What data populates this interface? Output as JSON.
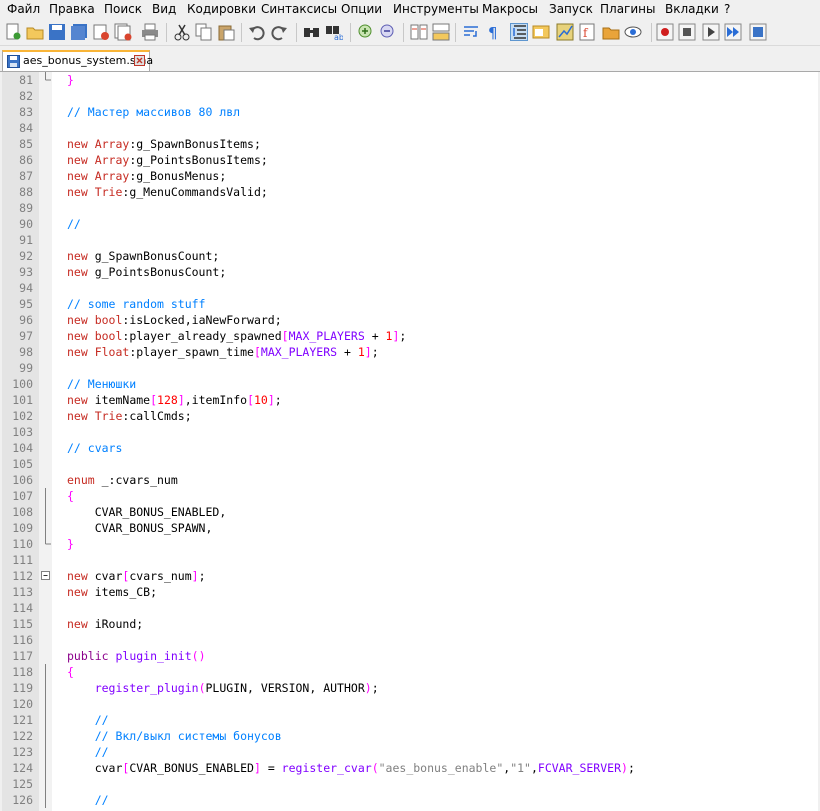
{
  "menu": [
    "Файл",
    "Правка",
    "Поиск",
    "Вид",
    "Кодировки",
    "Синтаксисы",
    "Опции",
    "Инструменты",
    "Макросы",
    "Запуск",
    "Плагины",
    "Вкладки",
    "?"
  ],
  "toolbar_icons": [
    "new-file-icon",
    "open-file-icon",
    "save-icon",
    "save-all-icon",
    "close-icon",
    "close-all-icon",
    "print-icon",
    "cut-icon",
    "copy-icon",
    "paste-icon",
    "undo-icon",
    "redo-icon",
    "find-icon",
    "replace-icon",
    "zoom-in-icon",
    "zoom-out-icon",
    "sync-vertical-icon",
    "sync-horizontal-icon",
    "word-wrap-icon",
    "show-all-chars-icon",
    "indent-guide-icon",
    "user-defined-lang-icon",
    "doc-map-icon",
    "function-list-icon",
    "folder-workspace-icon",
    "monitoring-icon",
    "record-macro-icon",
    "stop-record-icon",
    "playback-macro-icon",
    "run-macro-multiple-icon",
    "save-macro-icon"
  ],
  "tab": {
    "filename": "aes_bonus_system.sma"
  },
  "colors": {
    "keyword": "#c62b22",
    "comment": "#0080ff",
    "function": "#8b008b",
    "number": "#ff0000",
    "bracket": "#ff00ff",
    "tab_accent": "#f9b538"
  },
  "lines": [
    {
      "n": "81",
      "fold": "end",
      "code": [
        [
          "}",
          "br"
        ]
      ]
    },
    {
      "n": "82",
      "fold": "",
      "code": []
    },
    {
      "n": "83",
      "fold": "",
      "code": [
        [
          "// Мастер массивов 80 лвл",
          "cm"
        ]
      ]
    },
    {
      "n": "84",
      "fold": "",
      "code": []
    },
    {
      "n": "85",
      "fold": "",
      "code": [
        [
          "new ",
          "kw"
        ],
        [
          "Array",
          "kw"
        ],
        [
          ":g_SpawnBonusItems;",
          ""
        ]
      ]
    },
    {
      "n": "86",
      "fold": "",
      "code": [
        [
          "new ",
          "kw"
        ],
        [
          "Array",
          "kw"
        ],
        [
          ":g_PointsBonusItems;",
          ""
        ]
      ]
    },
    {
      "n": "87",
      "fold": "",
      "code": [
        [
          "new ",
          "kw"
        ],
        [
          "Array",
          "kw"
        ],
        [
          ":g_BonusMenus;",
          ""
        ]
      ]
    },
    {
      "n": "88",
      "fold": "",
      "code": [
        [
          "new ",
          "kw"
        ],
        [
          "Trie",
          "kw"
        ],
        [
          ":g_MenuCommandsValid;",
          ""
        ]
      ]
    },
    {
      "n": "89",
      "fold": "",
      "code": []
    },
    {
      "n": "90",
      "fold": "",
      "code": [
        [
          "//",
          "cm"
        ]
      ]
    },
    {
      "n": "91",
      "fold": "",
      "code": []
    },
    {
      "n": "92",
      "fold": "",
      "code": [
        [
          "new ",
          "kw"
        ],
        [
          "g_SpawnBonusCount;",
          ""
        ]
      ]
    },
    {
      "n": "93",
      "fold": "",
      "code": [
        [
          "new ",
          "kw"
        ],
        [
          "g_PointsBonusCount;",
          ""
        ]
      ]
    },
    {
      "n": "94",
      "fold": "",
      "code": []
    },
    {
      "n": "95",
      "fold": "",
      "code": [
        [
          "// some random stuff",
          "cm"
        ]
      ]
    },
    {
      "n": "96",
      "fold": "",
      "code": [
        [
          "new ",
          "kw"
        ],
        [
          "bool",
          "kw"
        ],
        [
          ":isLocked,iaNewForward;",
          ""
        ]
      ]
    },
    {
      "n": "97",
      "fold": "",
      "code": [
        [
          "new ",
          "kw"
        ],
        [
          "bool",
          "kw"
        ],
        [
          ":player_already_spawned",
          ""
        ],
        [
          "[",
          "br"
        ],
        [
          "MAX_PLAYERS",
          "cn"
        ],
        [
          " + ",
          ""
        ],
        [
          "1",
          "nm"
        ],
        [
          "]",
          "br"
        ],
        [
          ";",
          ""
        ]
      ]
    },
    {
      "n": "98",
      "fold": "",
      "code": [
        [
          "new ",
          "kw"
        ],
        [
          "Float",
          "kw"
        ],
        [
          ":player_spawn_time",
          ""
        ],
        [
          "[",
          "br"
        ],
        [
          "MAX_PLAYERS",
          "cn"
        ],
        [
          " + ",
          ""
        ],
        [
          "1",
          "nm"
        ],
        [
          "]",
          "br"
        ],
        [
          ";",
          ""
        ]
      ]
    },
    {
      "n": "99",
      "fold": "",
      "code": []
    },
    {
      "n": "100",
      "fold": "",
      "code": [
        [
          "// Менюшки",
          "cm"
        ]
      ]
    },
    {
      "n": "101",
      "fold": "",
      "code": [
        [
          "new ",
          "kw"
        ],
        [
          "itemName",
          ""
        ],
        [
          "[",
          "br"
        ],
        [
          "128",
          "nm"
        ],
        [
          "]",
          "br"
        ],
        [
          ",itemInfo",
          ""
        ],
        [
          "[",
          "br"
        ],
        [
          "10",
          "nm"
        ],
        [
          "]",
          "br"
        ],
        [
          ";",
          ""
        ]
      ]
    },
    {
      "n": "102",
      "fold": "",
      "code": [
        [
          "new ",
          "kw"
        ],
        [
          "Trie",
          "kw"
        ],
        [
          ":callCmds;",
          ""
        ]
      ]
    },
    {
      "n": "103",
      "fold": "",
      "code": []
    },
    {
      "n": "104",
      "fold": "",
      "code": [
        [
          "// cvars",
          "cm"
        ]
      ]
    },
    {
      "n": "105",
      "fold": "",
      "code": []
    },
    {
      "n": "106",
      "fold": "",
      "code": [
        [
          "enum ",
          "kw"
        ],
        [
          "_:cvars_num",
          ""
        ]
      ]
    },
    {
      "n": "107",
      "fold": "open",
      "code": [
        [
          "{",
          "br"
        ]
      ]
    },
    {
      "n": "108",
      "fold": "line",
      "code": [
        [
          "    CVAR_BONUS_ENABLED,",
          ""
        ]
      ]
    },
    {
      "n": "109",
      "fold": "line",
      "code": [
        [
          "    CVAR_BONUS_SPAWN,",
          ""
        ]
      ]
    },
    {
      "n": "110",
      "fold": "end",
      "code": [
        [
          "}",
          "br"
        ]
      ]
    },
    {
      "n": "111",
      "fold": "",
      "code": []
    },
    {
      "n": "112",
      "fold": "box",
      "code": [
        [
          "new ",
          "kw"
        ],
        [
          "cvar",
          ""
        ],
        [
          "[",
          "br"
        ],
        [
          "cvars_num",
          ""
        ],
        [
          "]",
          "br"
        ],
        [
          ";",
          ""
        ]
      ]
    },
    {
      "n": "113",
      "fold": "",
      "code": [
        [
          "new ",
          "kw"
        ],
        [
          "items_CB;",
          ""
        ]
      ]
    },
    {
      "n": "114",
      "fold": "",
      "code": []
    },
    {
      "n": "115",
      "fold": "",
      "code": [
        [
          "new ",
          "kw"
        ],
        [
          "iRound;",
          ""
        ]
      ]
    },
    {
      "n": "116",
      "fold": "",
      "code": []
    },
    {
      "n": "117",
      "fold": "",
      "code": [
        [
          "public ",
          "fn"
        ],
        [
          "plugin_init",
          "pl"
        ],
        [
          "()",
          "br"
        ]
      ]
    },
    {
      "n": "118",
      "fold": "open",
      "code": [
        [
          "{",
          "br"
        ]
      ]
    },
    {
      "n": "119",
      "fold": "line",
      "code": [
        [
          "    ",
          ""
        ],
        [
          "register_plugin",
          "pl"
        ],
        [
          "(",
          "br"
        ],
        [
          "PLUGIN, VERSION, AUTHOR",
          ""
        ],
        [
          ")",
          "br"
        ],
        [
          ";",
          ""
        ]
      ]
    },
    {
      "n": "120",
      "fold": "line",
      "code": []
    },
    {
      "n": "121",
      "fold": "line",
      "code": [
        [
          "    //",
          "cm"
        ]
      ]
    },
    {
      "n": "122",
      "fold": "line",
      "code": [
        [
          "    // Вкл/выкл системы бонусов",
          "cm"
        ]
      ]
    },
    {
      "n": "123",
      "fold": "line",
      "code": [
        [
          "    //",
          "cm"
        ]
      ]
    },
    {
      "n": "124",
      "fold": "line",
      "code": [
        [
          "    cvar",
          ""
        ],
        [
          "[",
          "br"
        ],
        [
          "CVAR_BONUS_ENABLED",
          ""
        ],
        [
          "]",
          "br"
        ],
        [
          " = ",
          ""
        ],
        [
          "register_cvar",
          "pl"
        ],
        [
          "(",
          "br"
        ],
        [
          "\"aes_bonus_enable\"",
          "st"
        ],
        [
          ",",
          ""
        ],
        [
          "\"1\"",
          "st"
        ],
        [
          ",",
          ""
        ],
        [
          "FCVAR_SERVER",
          "cn"
        ],
        [
          ")",
          "br"
        ],
        [
          ";",
          ""
        ]
      ]
    },
    {
      "n": "125",
      "fold": "line",
      "code": []
    },
    {
      "n": "126",
      "fold": "line",
      "code": [
        [
          "    //",
          "cm"
        ]
      ]
    }
  ]
}
